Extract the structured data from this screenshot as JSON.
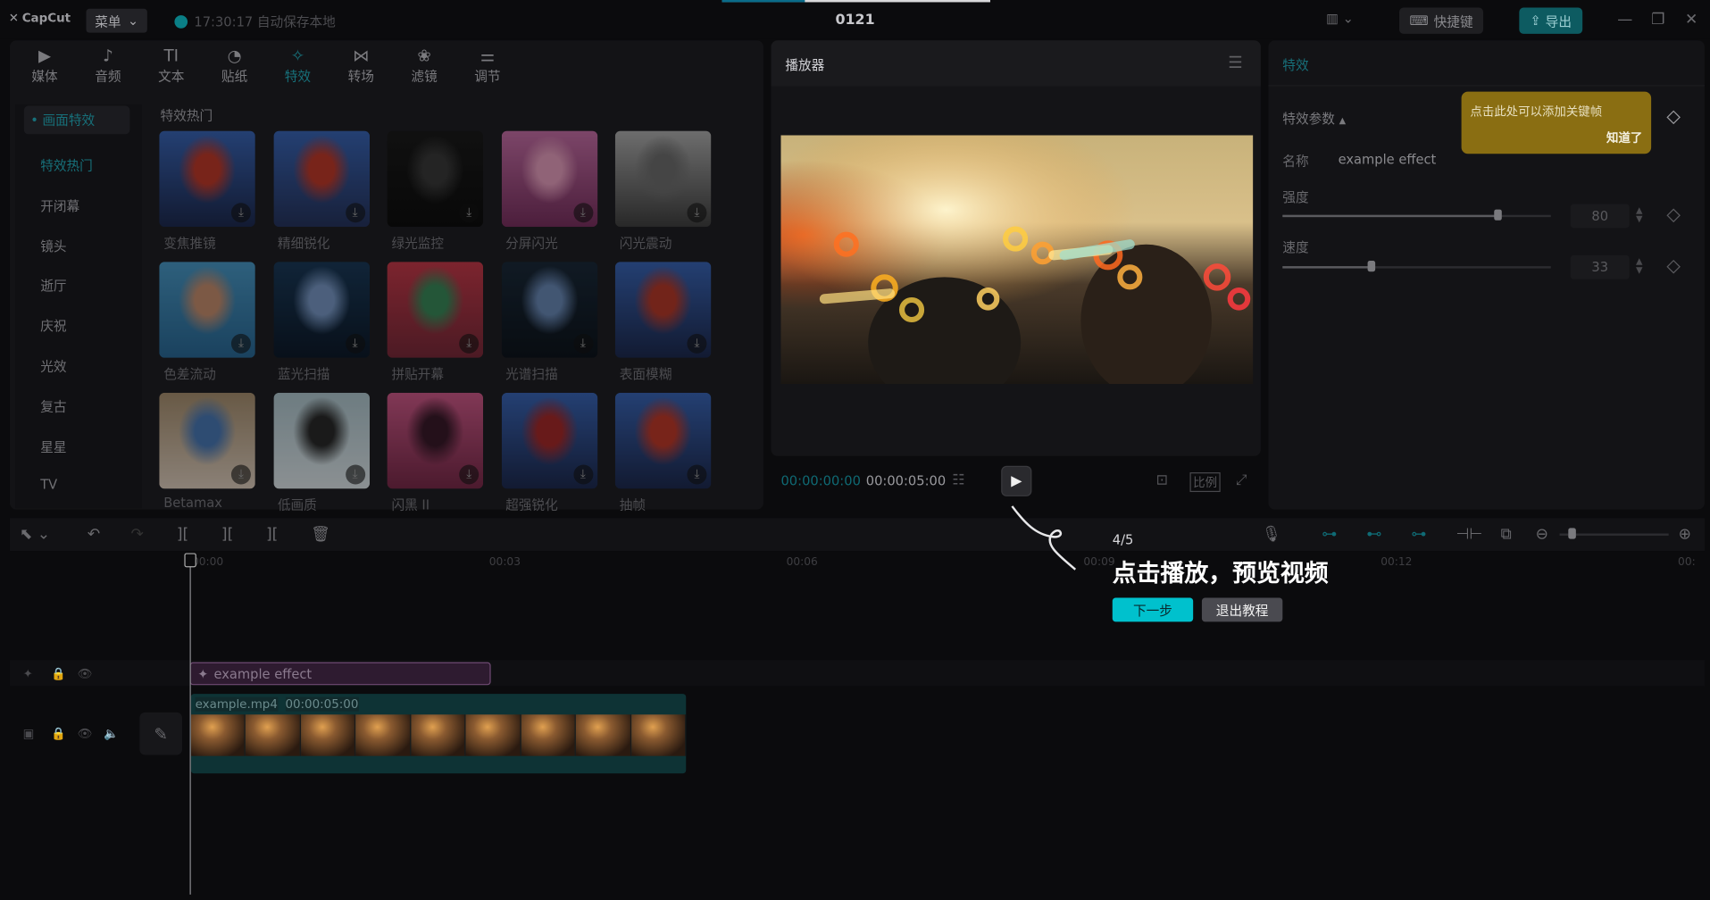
{
  "app": {
    "logo": "CapCut",
    "menu_label": "菜单",
    "autosave": "17:30:17 自动保存本地",
    "project_title": "0121",
    "shortcut_label": "快捷键",
    "export_label": "导出"
  },
  "tool_tabs": [
    {
      "label": "媒体",
      "icon": "media-icon"
    },
    {
      "label": "音频",
      "icon": "audio-icon"
    },
    {
      "label": "文本",
      "icon": "text-icon"
    },
    {
      "label": "贴纸",
      "icon": "sticker-icon"
    },
    {
      "label": "特效",
      "icon": "effects-icon",
      "active": true
    },
    {
      "label": "转场",
      "icon": "transition-icon"
    },
    {
      "label": "滤镜",
      "icon": "filter-icon"
    },
    {
      "label": "调节",
      "icon": "adjust-icon"
    }
  ],
  "categories": {
    "section": "• 画面特效",
    "items": [
      "特效热门",
      "开闭幕",
      "镜头",
      "逝厅",
      "庆祝",
      "光效",
      "复古",
      "星星",
      "TV"
    ]
  },
  "grid": {
    "title": "特效热门",
    "items": [
      "变焦推镜",
      "精细锐化",
      "绿光监控",
      "分屏闪光",
      "闪光震动",
      "色差流动",
      "蓝光扫描",
      "拼贴开幕",
      "光谱扫描",
      "表面模糊",
      "Betamax",
      "低画质",
      "闪黑 II",
      "超强锐化",
      "抽帧"
    ]
  },
  "player": {
    "title": "播放器",
    "timecode_current": "00:00:00:00",
    "timecode_total": "00:00:05:00",
    "ratio_label": "比例"
  },
  "props": {
    "title": "特效",
    "section": "特效参数",
    "name_label": "名称",
    "name_value": "example effect",
    "strength_label": "强度",
    "strength_value": "80",
    "speed_label": "速度",
    "speed_value": "33",
    "strength_level": 0.8,
    "speed_level": 0.33,
    "tooltip_text": "点击此处可以添加关键帧",
    "tooltip_ok": "知道了"
  },
  "timeline": {
    "ticks": [
      "00:00",
      "00:03",
      "00:06",
      "00:09",
      "00:12",
      "00:"
    ],
    "effect_clip": "example effect",
    "video_clip_name": "example.mp4",
    "video_clip_duration": "00:00:05:00"
  },
  "tutorial": {
    "step": "4/5",
    "title": "点击播放，预览视频",
    "next": "下一步",
    "exit": "退出教程"
  },
  "colors": {
    "accent": "#17707a",
    "tutorial_button": "#00c1cd",
    "tooltip": "#8a6e12"
  }
}
